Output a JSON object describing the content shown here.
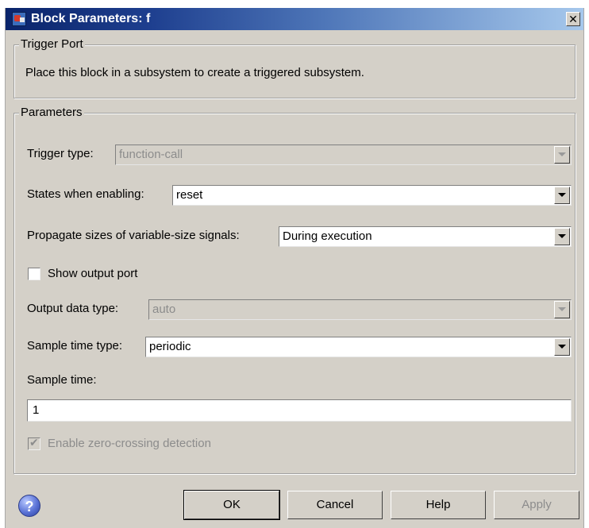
{
  "window": {
    "title": "Block Parameters: f",
    "close_glyph": "✕"
  },
  "trigger_port": {
    "legend": "Trigger Port",
    "description": "Place this block in a subsystem to create a triggered subsystem."
  },
  "parameters": {
    "legend": "Parameters",
    "trigger_type": {
      "label": "Trigger type:",
      "value": "function-call",
      "enabled": false
    },
    "states_when_enabling": {
      "label": "States when enabling:",
      "value": "reset",
      "enabled": true
    },
    "propagate_sizes": {
      "label": "Propagate sizes of variable-size signals:",
      "value": "During execution",
      "enabled": true
    },
    "show_output_port": {
      "label": "Show output port",
      "checked": false,
      "enabled": true
    },
    "output_data_type": {
      "label": "Output data type:",
      "value": "auto",
      "enabled": false
    },
    "sample_time_type": {
      "label": "Sample time type:",
      "value": "periodic",
      "enabled": true
    },
    "sample_time": {
      "label": "Sample time:",
      "value": "1"
    },
    "zero_crossing": {
      "label": "Enable zero-crossing detection",
      "checked": true,
      "enabled": false
    }
  },
  "buttons": {
    "help_icon": "?",
    "ok": "OK",
    "cancel": "Cancel",
    "help": "Help",
    "apply": "Apply"
  },
  "colors": {
    "dialog_bg": "#d4d0c8",
    "title_gradient_start": "#0a246a",
    "title_gradient_end": "#a6c8ec",
    "disabled_text": "#8c8c8c"
  },
  "icons": {
    "window_icon": "simulink-block-icon",
    "help": "help-question-icon",
    "dropdown": "chevron-down-icon",
    "checkmark": "checkmark-icon"
  }
}
